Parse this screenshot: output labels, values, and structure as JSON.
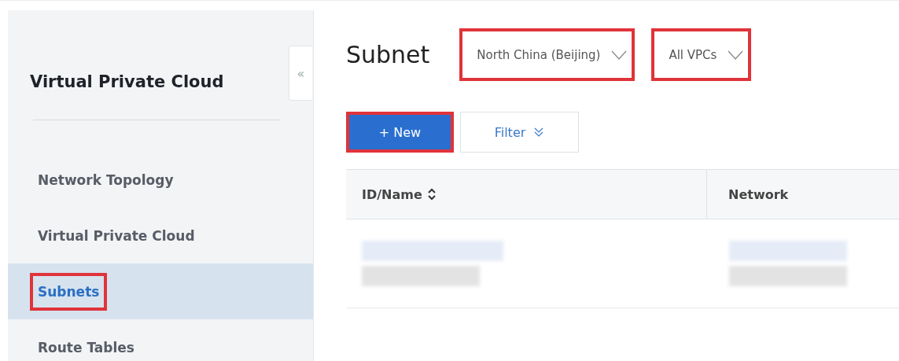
{
  "sidebar": {
    "title": "Virtual Private Cloud",
    "collapse_icon": "«",
    "items": [
      {
        "label": "Network Topology",
        "selected": false,
        "highlighted": false
      },
      {
        "label": "Virtual Private Cloud",
        "selected": false,
        "highlighted": false
      },
      {
        "label": "Subnets",
        "selected": true,
        "highlighted": true
      },
      {
        "label": "Route Tables",
        "selected": false,
        "highlighted": false
      }
    ]
  },
  "page": {
    "title": "Subnet",
    "dropdowns": [
      {
        "value": "North China (Beijing)",
        "highlighted": true
      },
      {
        "value": "All VPCs",
        "highlighted": true
      }
    ],
    "toolbar": [
      {
        "kind": "primary",
        "label": "+ New",
        "highlighted": true
      },
      {
        "kind": "filter",
        "label": "Filter",
        "highlighted": false
      }
    ]
  },
  "table": {
    "columns": [
      {
        "label": "ID/Name",
        "sortable": true
      },
      {
        "label": "Network",
        "sortable": false
      }
    ],
    "rows": [
      {
        "kind": "redacted"
      }
    ]
  }
}
